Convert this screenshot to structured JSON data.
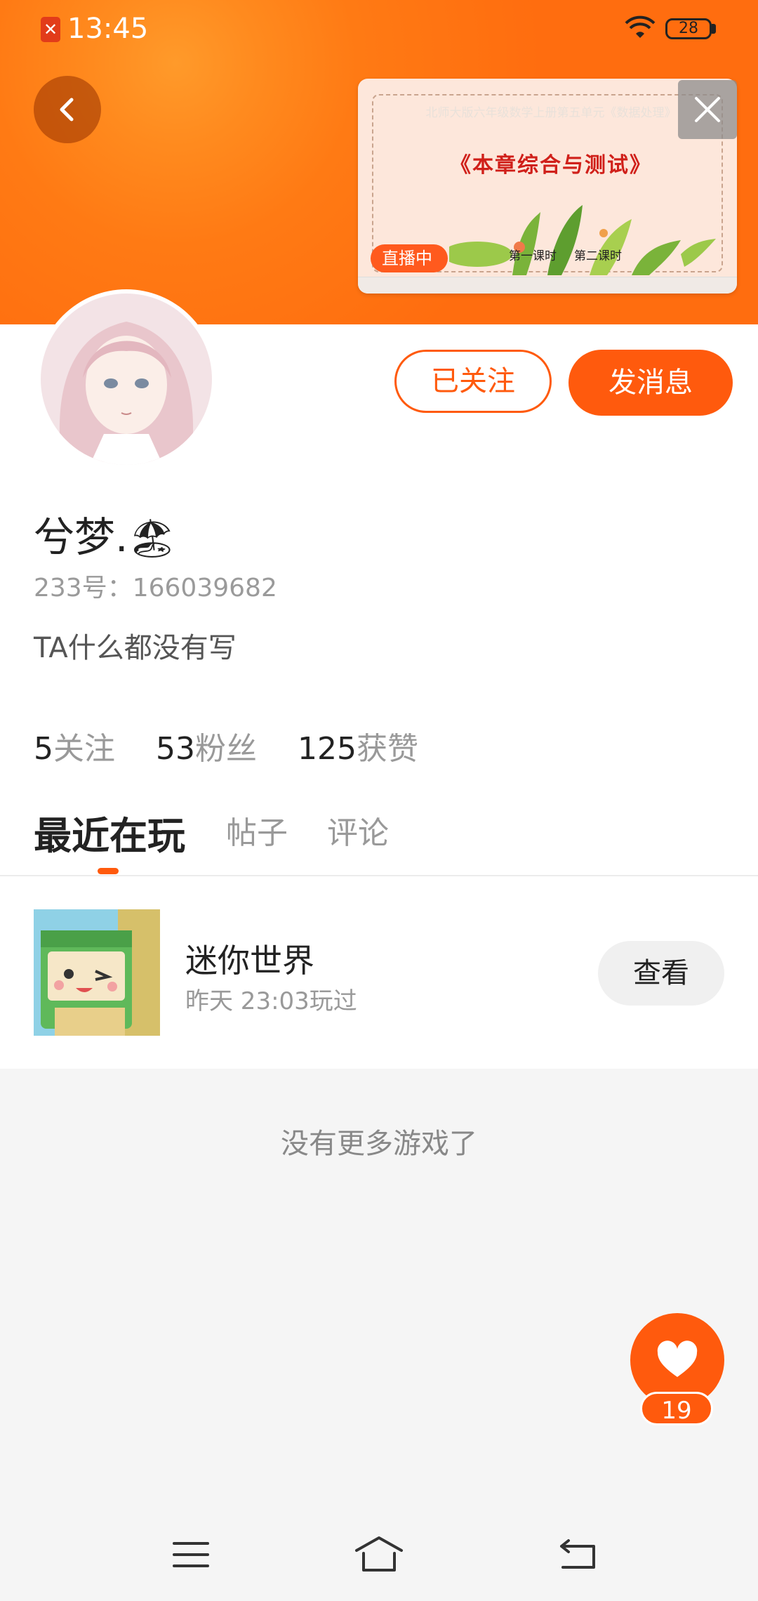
{
  "status_bar": {
    "time": "13:45",
    "battery": "28"
  },
  "live": {
    "course": "北师大版六年级数学上册第五单元《数据处理》",
    "title": "《本章综合与测试》",
    "lesson1": "第一课时",
    "lesson2": "第二课时",
    "badge": "直播中"
  },
  "profile": {
    "follow_label": "已关注",
    "message_label": "发消息",
    "name": "兮梦.",
    "name_emoji": "🏖",
    "id_text": "233号：166039682",
    "bio": "TA什么都没有写"
  },
  "stats": [
    {
      "value": "5",
      "label": "关注"
    },
    {
      "value": "53",
      "label": "粉丝"
    },
    {
      "value": "125",
      "label": "获赞"
    }
  ],
  "tabs": [
    "最近在玩",
    "帖子",
    "评论"
  ],
  "game": {
    "name": "迷你世界",
    "time": "昨天 23:03玩过",
    "view_label": "查看"
  },
  "no_more": "没有更多游戏了",
  "likes": "19",
  "colors": {
    "accent": "#ff5a0d",
    "header": "#ff7a14"
  }
}
